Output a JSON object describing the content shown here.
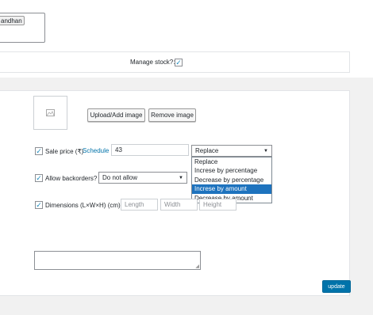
{
  "top": {
    "tag_label": "andhan"
  },
  "stock": {
    "manage_label": "Manage stock?:",
    "checked": true
  },
  "image": {
    "upload_label": "Upload/Add image",
    "remove_label": "Remove image"
  },
  "sale": {
    "label": "Sale price (₹)",
    "schedule_link": "Schedule",
    "value": "43",
    "dropdown": {
      "selected": "Replace",
      "options": [
        "Replace",
        "Increse by percentage",
        "Decrease by percentage",
        "Increse by amount",
        "Decrease by amount"
      ],
      "highlighted_index": 3
    }
  },
  "backorders": {
    "label": "Allow backorders?",
    "selected": "Do not allow"
  },
  "dimensions": {
    "label": "Dimensions (L×W×H) (cm)",
    "length_placeholder": "Length",
    "width_placeholder": "Width",
    "height_placeholder": "Height"
  },
  "footer": {
    "update_label": "update"
  },
  "colors": {
    "accent": "#0073aa",
    "highlight": "#1e73be",
    "border": "#ccd0d4",
    "page_bg": "#f1f1f1"
  }
}
